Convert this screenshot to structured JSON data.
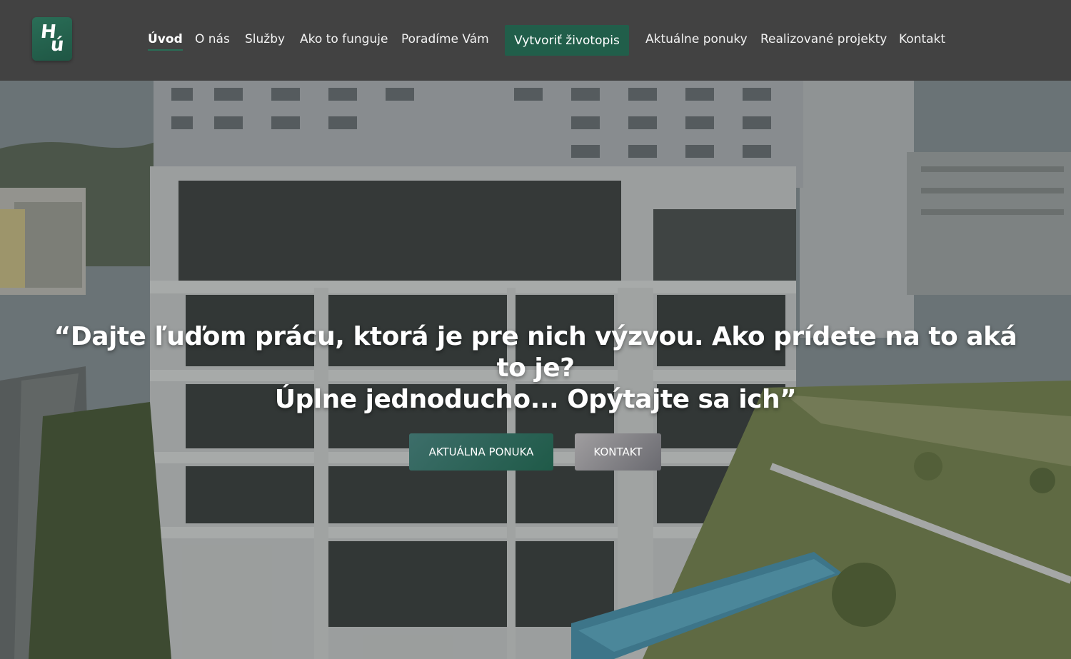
{
  "logo": {
    "line1": "H",
    "line2": "ú"
  },
  "nav": {
    "items": [
      {
        "label": "Úvod",
        "active": true
      },
      {
        "label": "O nás"
      },
      {
        "label": "Služby"
      },
      {
        "label": "Ako to funguje"
      },
      {
        "label": "Poradíme Vám"
      },
      {
        "label": "Aktuálne ponuky"
      },
      {
        "label": "Realizované projekty"
      },
      {
        "label": "Kontakt"
      }
    ],
    "cta_label": "Vytvoriť životopis"
  },
  "hero": {
    "quote_line1": "“Dajte ľuďom prácu, ktorá je pre nich výzvou. Ako prídete na to aká to je?",
    "quote_line2": "Úplne jednoducho... Opýtajte sa ich”",
    "primary_button": "AKTUÁLNA PONUKA",
    "secondary_button": "KONTAKT"
  },
  "colors": {
    "header_bg": "#424242",
    "brand_green": "#215e4a",
    "text_light": "#ffffff"
  }
}
